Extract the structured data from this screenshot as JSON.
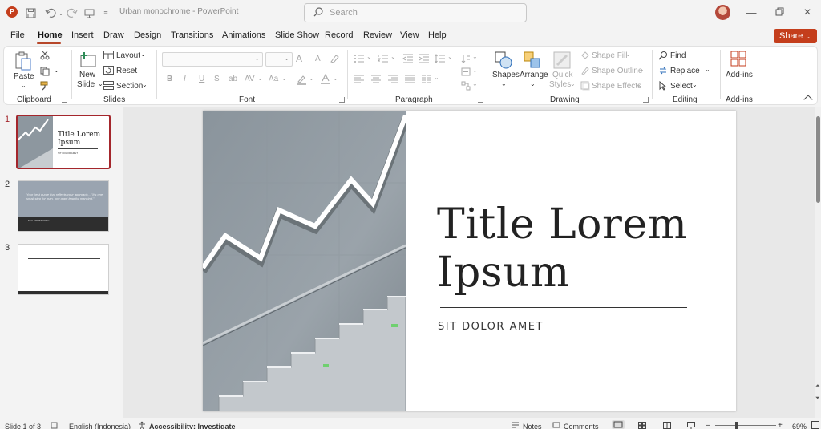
{
  "titlebar": {
    "document_title": "Urban monochrome  -  PowerPoint",
    "search_placeholder": "Search",
    "app_icon_label": "P"
  },
  "menu": {
    "tabs": [
      "File",
      "Home",
      "Insert",
      "Draw",
      "Design",
      "Transitions",
      "Animations",
      "Slide Show",
      "Record",
      "Review",
      "View",
      "Help"
    ],
    "active_tab": "Home",
    "share_label": "Share"
  },
  "ribbon": {
    "clipboard": {
      "paste": "Paste",
      "group": "Clipboard"
    },
    "slides": {
      "new_slide_line1": "New",
      "new_slide_line2": "Slide",
      "layout": "Layout",
      "reset": "Reset",
      "section": "Section",
      "group": "Slides"
    },
    "font": {
      "group": "Font",
      "bold": "B",
      "italic": "I",
      "underline": "U",
      "strike": "S",
      "shadow": "ab",
      "spacing": "AV",
      "case": "Aa",
      "grow": "A",
      "shrink": "A"
    },
    "paragraph": {
      "group": "Paragraph"
    },
    "drawing": {
      "shapes": "Shapes",
      "arrange": "Arrange",
      "quick_styles_1": "Quick",
      "quick_styles_2": "Styles",
      "shape_fill": "Shape Fill",
      "shape_outline": "Shape Outline",
      "shape_effects": "Shape Effects",
      "group": "Drawing"
    },
    "editing": {
      "find": "Find",
      "replace": "Replace",
      "select": "Select",
      "group": "Editing"
    },
    "addins": {
      "label": "Add-ins",
      "group": "Add-ins"
    }
  },
  "thumbnails": [
    {
      "number": "1",
      "title": "Title Lorem Ipsum",
      "sub": "SIT DOLOR AMET",
      "selected": true
    },
    {
      "number": "2",
      "quote": "Your best quote that reflects your approach... \"It's one small step for man, one giant leap for mankind.\"",
      "author": "- NEIL ARMSTRONG"
    },
    {
      "number": "3"
    }
  ],
  "slide": {
    "title_line1": "Title Lorem",
    "title_line2": "Ipsum",
    "subtitle": "SIT DOLOR AMET"
  },
  "status": {
    "slide_counter": "Slide 1 of 3",
    "language": "English (Indonesia)",
    "accessibility": "Accessibility: Investigate",
    "notes": "Notes",
    "comments": "Comments",
    "zoom": "69%"
  },
  "colors": {
    "accent": "#c43e1c",
    "selection": "#a4262c",
    "underline": "#b7472a"
  }
}
